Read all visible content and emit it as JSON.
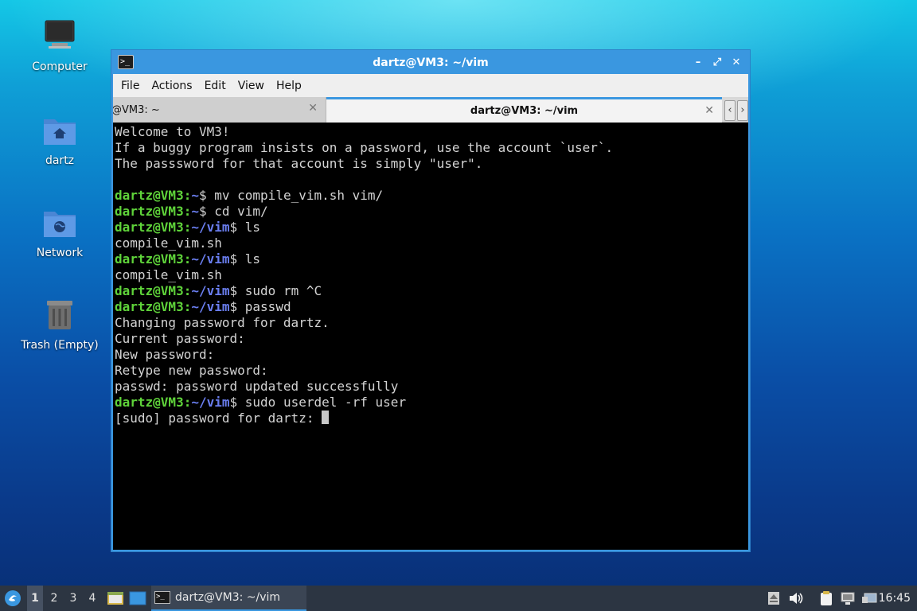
{
  "desktop": {
    "icons": [
      {
        "label": "Computer"
      },
      {
        "label": "dartz"
      },
      {
        "label": "Network"
      },
      {
        "label": "Trash (Empty)"
      }
    ]
  },
  "window": {
    "title": "dartz@VM3: ~/vim",
    "menu": [
      "File",
      "Actions",
      "Edit",
      "View",
      "Help"
    ],
    "tabs": [
      {
        "label": "@VM3: ~",
        "active": false
      },
      {
        "label": "dartz@VM3: ~/vim",
        "active": true
      }
    ],
    "terminal": {
      "lines": [
        {
          "text": "Welcome to VM3!"
        },
        {
          "text": "If a buggy program insists on a password, use the account `user`."
        },
        {
          "text": "The passsword for that account is simply \"user\"."
        },
        {
          "text": ""
        },
        {
          "user": "dartz@VM3",
          "path": "~",
          "cmd": "mv compile_vim.sh vim/"
        },
        {
          "user": "dartz@VM3",
          "path": "~",
          "cmd": "cd vim/"
        },
        {
          "user": "dartz@VM3",
          "path": "~/vim",
          "cmd": "ls"
        },
        {
          "text": "compile_vim.sh"
        },
        {
          "user": "dartz@VM3",
          "path": "~/vim",
          "cmd": "ls"
        },
        {
          "text": "compile_vim.sh"
        },
        {
          "user": "dartz@VM3",
          "path": "~/vim",
          "cmd": "sudo rm ^C"
        },
        {
          "user": "dartz@VM3",
          "path": "~/vim",
          "cmd": "passwd"
        },
        {
          "text": "Changing password for dartz."
        },
        {
          "text": "Current password:"
        },
        {
          "text": "New password:"
        },
        {
          "text": "Retype new password:"
        },
        {
          "text": "passwd: password updated successfully"
        },
        {
          "user": "dartz@VM3",
          "path": "~/vim",
          "cmd": "sudo userdel -rf user"
        },
        {
          "text": "[sudo] password for dartz: ",
          "cursor": true
        }
      ]
    }
  },
  "taskbar": {
    "workspaces": [
      "1",
      "2",
      "3",
      "4"
    ],
    "active_workspace": "1",
    "task_label": "dartz@VM3: ~/vim",
    "clock": "16:45"
  },
  "colors": {
    "accent": "#3a97e0",
    "prompt_user": "#5fd33a",
    "prompt_path": "#6a7ef0",
    "taskbar": "#2c3542"
  }
}
